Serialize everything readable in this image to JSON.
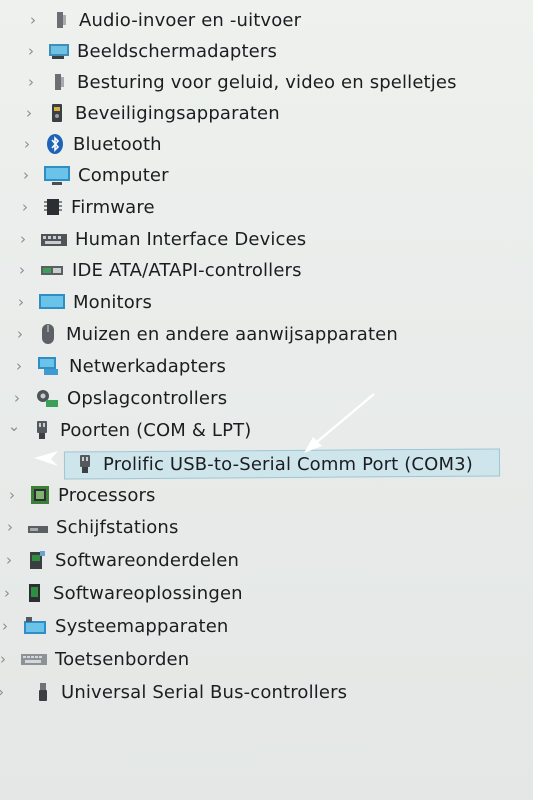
{
  "device_manager": {
    "categories": [
      {
        "label": "Audio-invoer en -uitvoer",
        "icon": "speaker-icon"
      },
      {
        "label": "Beeldschermadapters",
        "icon": "display-adapter-icon"
      },
      {
        "label": "Besturing voor geluid, video en spelletjes",
        "icon": "sound-icon"
      },
      {
        "label": "Beveiligingsapparaten",
        "icon": "security-key-icon"
      },
      {
        "label": "Bluetooth",
        "icon": "bluetooth-icon"
      },
      {
        "label": "Computer",
        "icon": "computer-icon"
      },
      {
        "label": "Firmware",
        "icon": "chip-icon"
      },
      {
        "label": "Human Interface Devices",
        "icon": "keyboard-hid-icon"
      },
      {
        "label": "IDE ATA/ATAPI-controllers",
        "icon": "ide-controller-icon"
      },
      {
        "label": "Monitors",
        "icon": "monitor-icon"
      },
      {
        "label": "Muizen en andere aanwijsapparaten",
        "icon": "mouse-icon"
      },
      {
        "label": "Netwerkadapters",
        "icon": "network-icon"
      },
      {
        "label": "Opslagcontrollers",
        "icon": "storage-icon"
      },
      {
        "label": "Poorten (COM & LPT)",
        "icon": "port-icon"
      },
      {
        "label": "Prolific USB-to-Serial Comm Port (COM3)",
        "icon": "serial-port-icon"
      },
      {
        "label": "Processors",
        "icon": "processor-icon"
      },
      {
        "label": "Schijfstations",
        "icon": "disk-drive-icon"
      },
      {
        "label": "Softwareonderdelen",
        "icon": "software-component-icon"
      },
      {
        "label": "Softwareoplossingen",
        "icon": "software-device-icon"
      },
      {
        "label": "Systeemapparaten",
        "icon": "system-device-icon"
      },
      {
        "label": "Toetsenborden",
        "icon": "keyboard-icon"
      },
      {
        "label": "Universal Serial Bus-controllers",
        "icon": "usb-icon"
      }
    ],
    "chevrons": {
      "collapsed": "›",
      "expanded": "⌄"
    },
    "colors": {
      "background": "#e9ecea",
      "selection": "#cfe5ec",
      "text": "#1b1e20"
    }
  }
}
